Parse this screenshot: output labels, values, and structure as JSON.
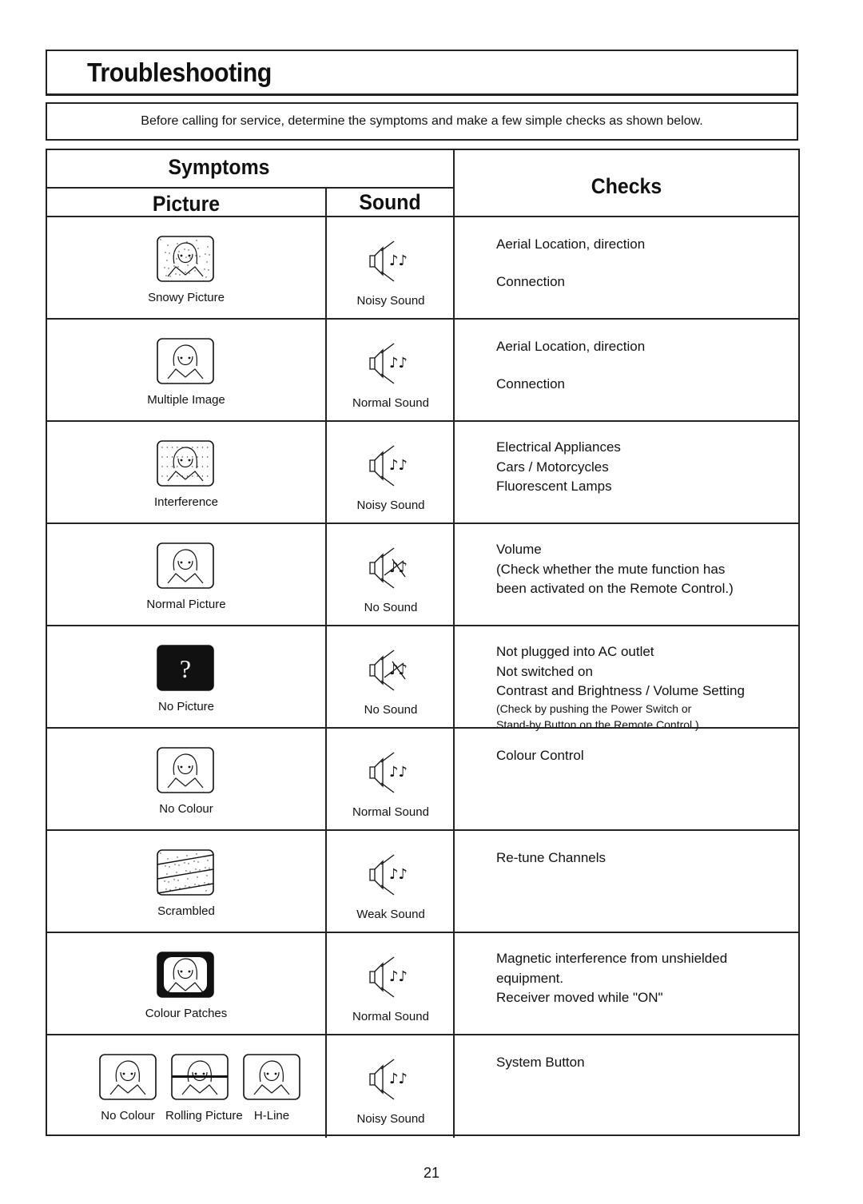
{
  "header": {
    "title": "Troubleshooting",
    "intro": "Before calling for service, determine the symptoms and make a few simple checks as shown below."
  },
  "table": {
    "symptoms_header": "Symptoms",
    "picture_header": "Picture",
    "sound_header": "Sound",
    "checks_header": "Checks",
    "rows": [
      {
        "picture": "Snowy Picture",
        "picture_icon": "snowy-tv-icon",
        "sound": "Noisy Sound",
        "sound_icon": "speaker-icon",
        "checks": [
          "Aerial Location, direction",
          "Connection"
        ]
      },
      {
        "picture": "Multiple Image",
        "picture_icon": "ghost-tv-icon",
        "sound": "Normal Sound",
        "sound_icon": "speaker-icon",
        "checks": [
          "Aerial Location, direction",
          "Connection"
        ]
      },
      {
        "picture": "Interference",
        "picture_icon": "interference-tv-icon",
        "sound": "Noisy Sound",
        "sound_icon": "speaker-icon",
        "checks": [
          "Electrical Appliances",
          "Cars / Motorcycles",
          "Fluorescent Lamps"
        ]
      },
      {
        "picture": "Normal Picture",
        "picture_icon": "normal-tv-icon",
        "sound": "No Sound",
        "sound_icon": "muted-speaker-icon",
        "checks": [
          "Volume",
          "(Check whether the mute function has",
          "been activated on the Remote Control.)"
        ]
      },
      {
        "picture": "No Picture",
        "picture_icon": "no-picture-tv-icon",
        "sound": "No Sound",
        "sound_icon": "muted-speaker-icon",
        "checks": [
          "Not plugged into AC outlet",
          "Not switched on",
          "Contrast and Brightness / Volume Setting"
        ],
        "checks_small": [
          "(Check by pushing the Power Switch or",
          " Stand-by Button on the Remote Control.)"
        ]
      },
      {
        "picture": "No Colour",
        "picture_icon": "normal-tv-icon",
        "sound": "Normal Sound",
        "sound_icon": "speaker-icon",
        "checks": [
          "Colour Control"
        ]
      },
      {
        "picture": "Scrambled",
        "picture_icon": "scrambled-tv-icon",
        "sound": "Weak Sound",
        "sound_icon": "speaker-icon",
        "checks": [
          "Re-tune Channels"
        ]
      },
      {
        "picture": "Colour Patches",
        "picture_icon": "colour-patches-tv-icon",
        "sound": "Normal Sound",
        "sound_icon": "speaker-icon",
        "checks": [
          "Magnetic interference from unshielded",
          "equipment.",
          "Receiver moved while \"ON\""
        ]
      },
      {
        "pictures": [
          "No Colour",
          "Rolling Picture",
          "H-Line"
        ],
        "sound": "Noisy Sound",
        "sound_icon": "speaker-icon",
        "checks": [
          "System Button"
        ]
      }
    ]
  },
  "footer": {
    "page_number": "21"
  }
}
